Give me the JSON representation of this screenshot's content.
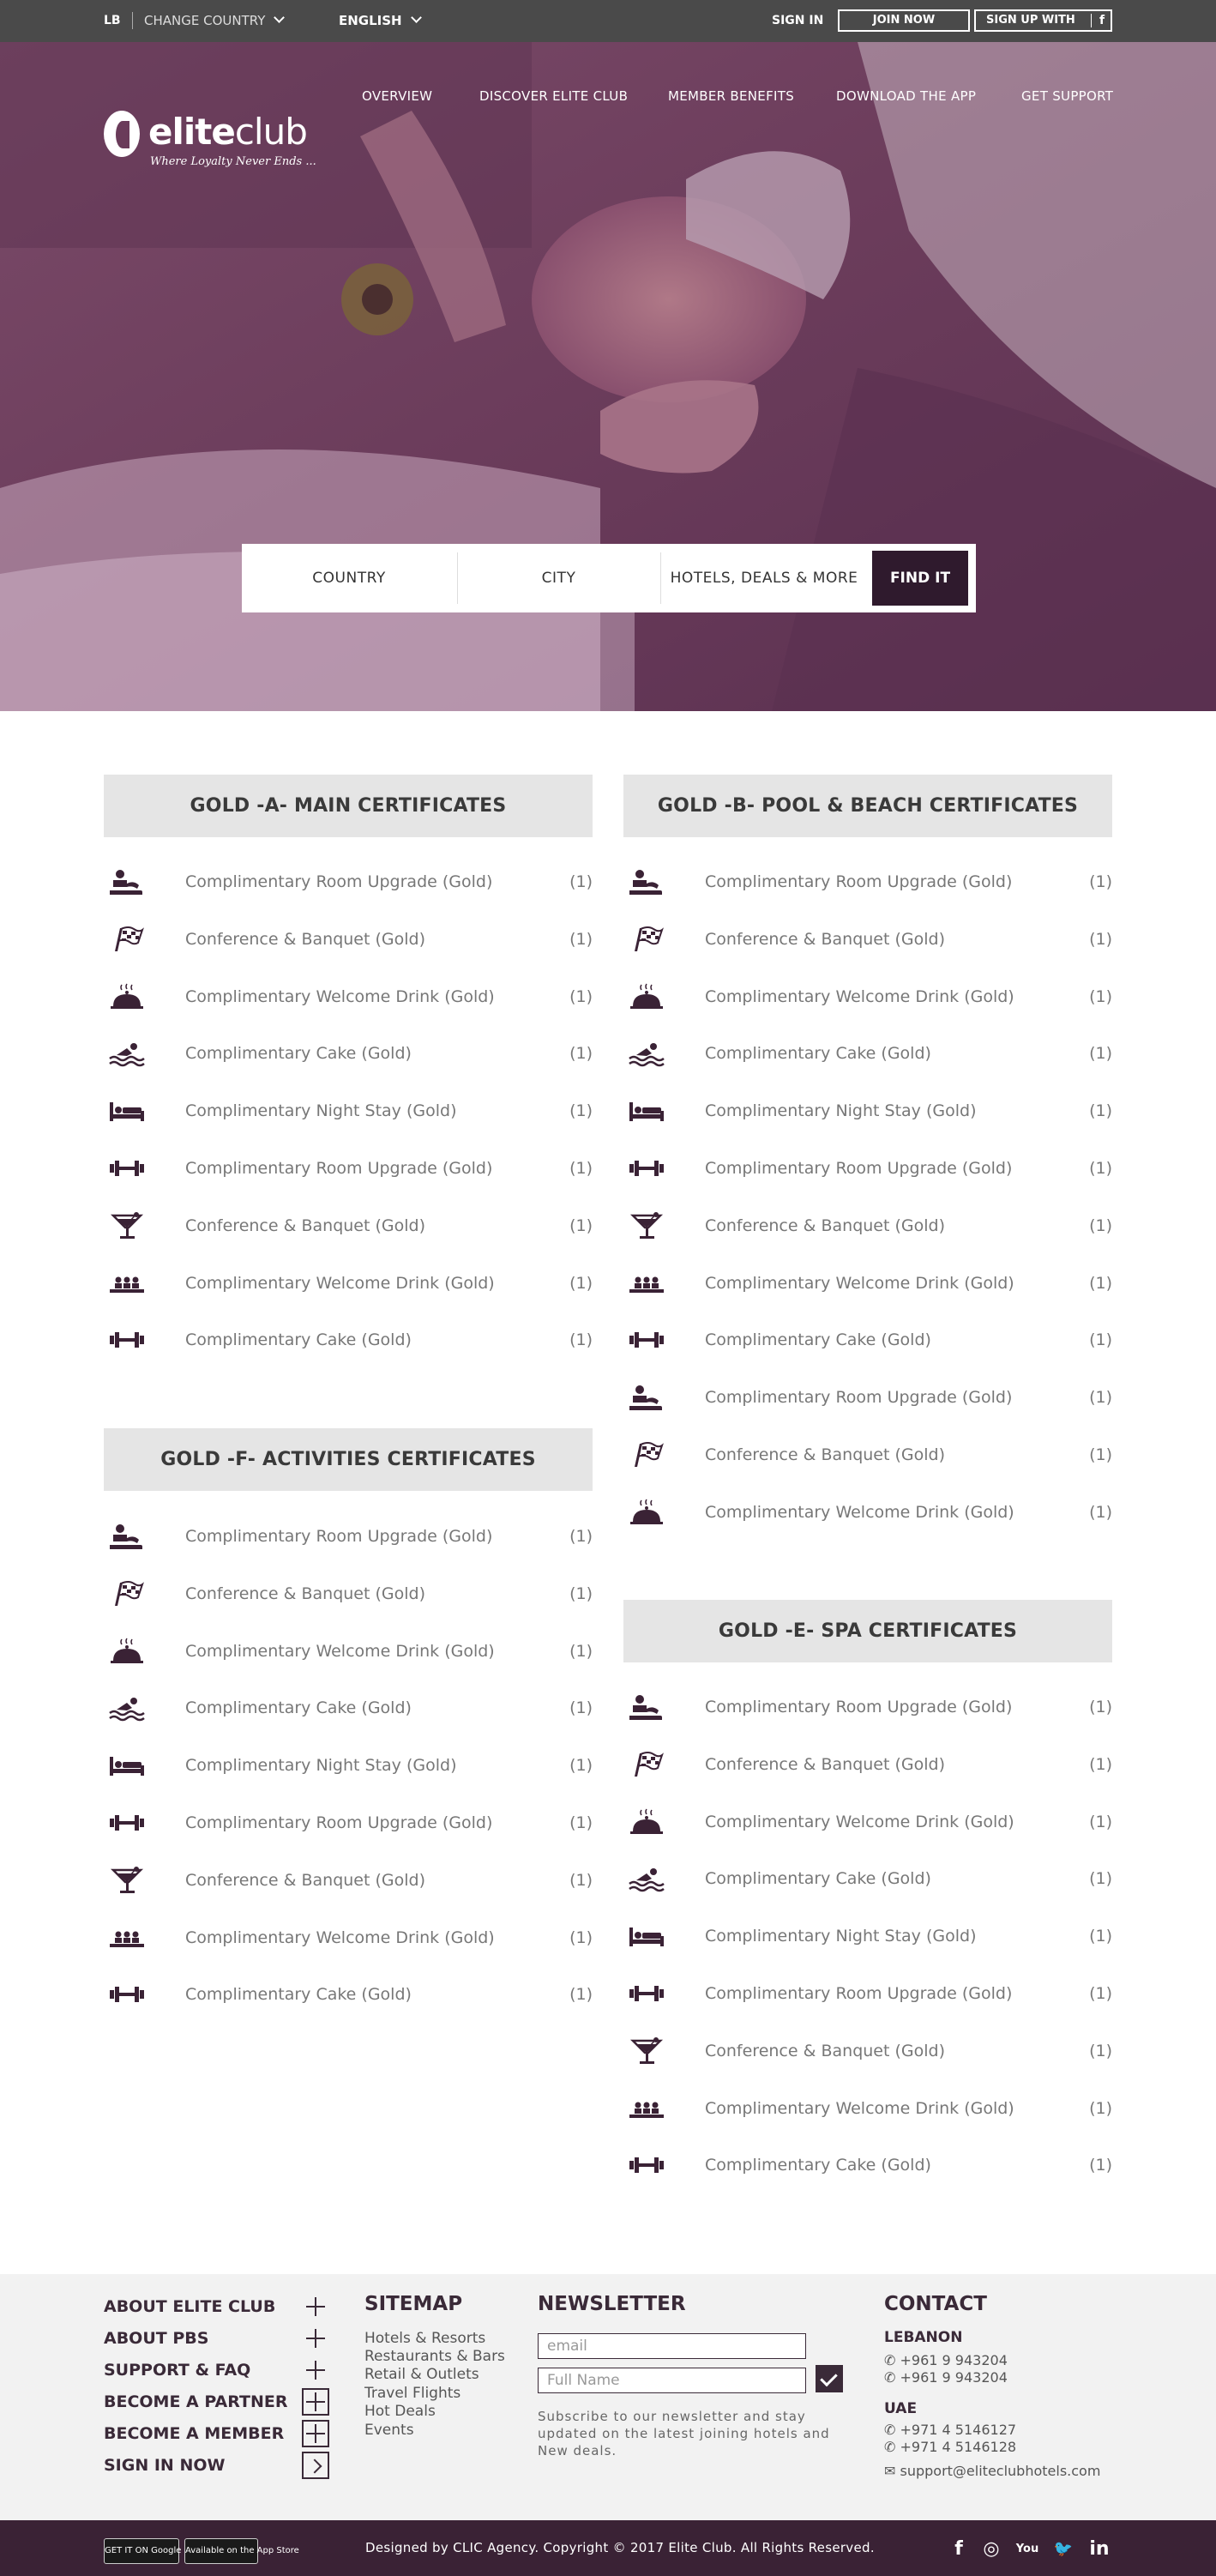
{
  "topbar": {
    "country_code": "LB",
    "change_country": "CHANGE COUNTRY",
    "language": "ENGLISH",
    "sign_in": "SIGN IN",
    "join_now": "JOIN NOW",
    "sign_up_with": "SIGN UP WITH",
    "facebook_glyph": "f"
  },
  "logo": {
    "word1": "elite",
    "word2": "club",
    "tagline": "Where Loyalty Never Ends ..."
  },
  "nav": {
    "items": [
      "OVERVIEW",
      "DISCOVER ELITE CLUB",
      "MEMBER BENEFITS",
      "DOWNLOAD THE APP",
      "GET SUPPORT"
    ]
  },
  "search": {
    "country": "COUNTRY",
    "city": "CITY",
    "category": "HOTELS, DEALS & MORE",
    "find": "FIND IT"
  },
  "sections": {
    "a": {
      "title": "GOLD -A- MAIN CERTIFICATES",
      "rows": [
        {
          "icon": "spa-massage-icon",
          "label": "Complimentary Room Upgrade (Gold)",
          "count": "(1)"
        },
        {
          "icon": "racing-flag-icon",
          "label": "Conference & Banquet (Gold)",
          "count": "(1)"
        },
        {
          "icon": "food-cloche-icon",
          "label": "Complimentary Welcome Drink (Gold)",
          "count": "(1)"
        },
        {
          "icon": "swimming-icon",
          "label": "Complimentary Cake (Gold)",
          "count": "(1)"
        },
        {
          "icon": "bed-icon",
          "label": "Complimentary Night Stay (Gold)",
          "count": "(1)"
        },
        {
          "icon": "dumbbell-icon",
          "label": "Complimentary Room Upgrade (Gold)",
          "count": "(1)"
        },
        {
          "icon": "cocktail-icon",
          "label": "Conference & Banquet (Gold)",
          "count": "(1)"
        },
        {
          "icon": "meeting-table-icon",
          "label": "Complimentary Welcome Drink (Gold)",
          "count": "(1)"
        },
        {
          "icon": "dumbbell-icon",
          "label": "Complimentary Cake (Gold)",
          "count": "(1)"
        }
      ]
    },
    "b": {
      "title": "GOLD -B- POOL & BEACH CERTIFICATES",
      "rows": [
        {
          "icon": "spa-massage-icon",
          "label": "Complimentary Room Upgrade (Gold)",
          "count": "(1)"
        },
        {
          "icon": "racing-flag-icon",
          "label": "Conference & Banquet (Gold)",
          "count": "(1)"
        },
        {
          "icon": "food-cloche-icon",
          "label": "Complimentary Welcome Drink (Gold)",
          "count": "(1)"
        },
        {
          "icon": "swimming-icon",
          "label": "Complimentary Cake (Gold)",
          "count": "(1)"
        },
        {
          "icon": "bed-icon",
          "label": "Complimentary Night Stay (Gold)",
          "count": "(1)"
        },
        {
          "icon": "dumbbell-icon",
          "label": "Complimentary Room Upgrade (Gold)",
          "count": "(1)"
        },
        {
          "icon": "cocktail-icon",
          "label": "Conference & Banquet (Gold)",
          "count": "(1)"
        },
        {
          "icon": "meeting-table-icon",
          "label": "Complimentary Welcome Drink (Gold)",
          "count": "(1)"
        },
        {
          "icon": "dumbbell-icon",
          "label": "Complimentary Cake (Gold)",
          "count": "(1)"
        },
        {
          "icon": "spa-massage-icon",
          "label": "Complimentary Room Upgrade (Gold)",
          "count": "(1)"
        },
        {
          "icon": "racing-flag-icon",
          "label": "Conference & Banquet (Gold)",
          "count": "(1)"
        },
        {
          "icon": "food-cloche-icon",
          "label": "Complimentary Welcome Drink (Gold)",
          "count": "(1)"
        }
      ]
    },
    "f": {
      "title": "GOLD -F- ACTIVITIES CERTIFICATES",
      "rows": [
        {
          "icon": "spa-massage-icon",
          "label": "Complimentary Room Upgrade (Gold)",
          "count": "(1)"
        },
        {
          "icon": "racing-flag-icon",
          "label": "Conference & Banquet (Gold)",
          "count": "(1)"
        },
        {
          "icon": "food-cloche-icon",
          "label": "Complimentary Welcome Drink (Gold)",
          "count": "(1)"
        },
        {
          "icon": "swimming-icon",
          "label": "Complimentary Cake (Gold)",
          "count": "(1)"
        },
        {
          "icon": "bed-icon",
          "label": "Complimentary Night Stay (Gold)",
          "count": "(1)"
        },
        {
          "icon": "dumbbell-icon",
          "label": "Complimentary Room Upgrade (Gold)",
          "count": "(1)"
        },
        {
          "icon": "cocktail-icon",
          "label": "Conference & Banquet (Gold)",
          "count": "(1)"
        },
        {
          "icon": "meeting-table-icon",
          "label": "Complimentary Welcome Drink (Gold)",
          "count": "(1)"
        },
        {
          "icon": "dumbbell-icon",
          "label": "Complimentary Cake (Gold)",
          "count": "(1)"
        }
      ]
    },
    "e": {
      "title": "GOLD -E- SPA CERTIFICATES",
      "rows": [
        {
          "icon": "spa-massage-icon",
          "label": "Complimentary Room Upgrade (Gold)",
          "count": "(1)"
        },
        {
          "icon": "racing-flag-icon",
          "label": "Conference & Banquet (Gold)",
          "count": "(1)"
        },
        {
          "icon": "food-cloche-icon",
          "label": "Complimentary Welcome Drink (Gold)",
          "count": "(1)"
        },
        {
          "icon": "swimming-icon",
          "label": "Complimentary Cake (Gold)",
          "count": "(1)"
        },
        {
          "icon": "bed-icon",
          "label": "Complimentary Night Stay (Gold)",
          "count": "(1)"
        },
        {
          "icon": "dumbbell-icon",
          "label": "Complimentary Room Upgrade (Gold)",
          "count": "(1)"
        },
        {
          "icon": "cocktail-icon",
          "label": "Conference & Banquet (Gold)",
          "count": "(1)"
        },
        {
          "icon": "meeting-table-icon",
          "label": "Complimentary Welcome Drink (Gold)",
          "count": "(1)"
        },
        {
          "icon": "dumbbell-icon",
          "label": "Complimentary Cake (Gold)",
          "count": "(1)"
        }
      ]
    }
  },
  "footer": {
    "links": [
      "ABOUT ELITE CLUB",
      "ABOUT PBS",
      "SUPPORT & FAQ",
      "BECOME A PARTNER",
      "BECOME A MEMBER",
      "SIGN IN NOW"
    ],
    "sitemap_title": "SITEMAP",
    "sitemap": [
      "Hotels & Resorts",
      "Restaurants & Bars",
      "Retail & Outlets",
      "Travel Flights",
      "Hot Deals",
      "Events"
    ],
    "newsletter_title": "NEWSLETTER",
    "email_placeholder": "email",
    "name_placeholder": "Full Name",
    "newsletter_text": "Subscribe to our newsletter and stay updated on the latest joining hotels and New deals.",
    "contact_title": "CONTACT",
    "lebanon": "LEBANON",
    "lb_phone1": "+961 9 943204",
    "lb_phone2": "+961 9 943204",
    "uae": "UAE",
    "uae_phone1": "+971 4 5146127",
    "uae_phone2": "+971 4 5146128",
    "email": "support@eliteclubhotels.com"
  },
  "bottom": {
    "google_play": "GET IT ON Google play",
    "app_store": "Available on the App Store",
    "copyright": "Designed by CLIC Agency. Copyright © 2017 Elite Club. All Rights Reserved.",
    "social": [
      "facebook-icon",
      "instagram-icon",
      "youtube-icon",
      "twitter-icon",
      "linkedin-icon"
    ],
    "social_glyphs": [
      "f",
      "◎",
      "You",
      "🐦",
      "in"
    ]
  },
  "colors": {
    "brand": "#3a2235",
    "accent": "#2f1a2d",
    "hero": "#6e3f5f"
  }
}
